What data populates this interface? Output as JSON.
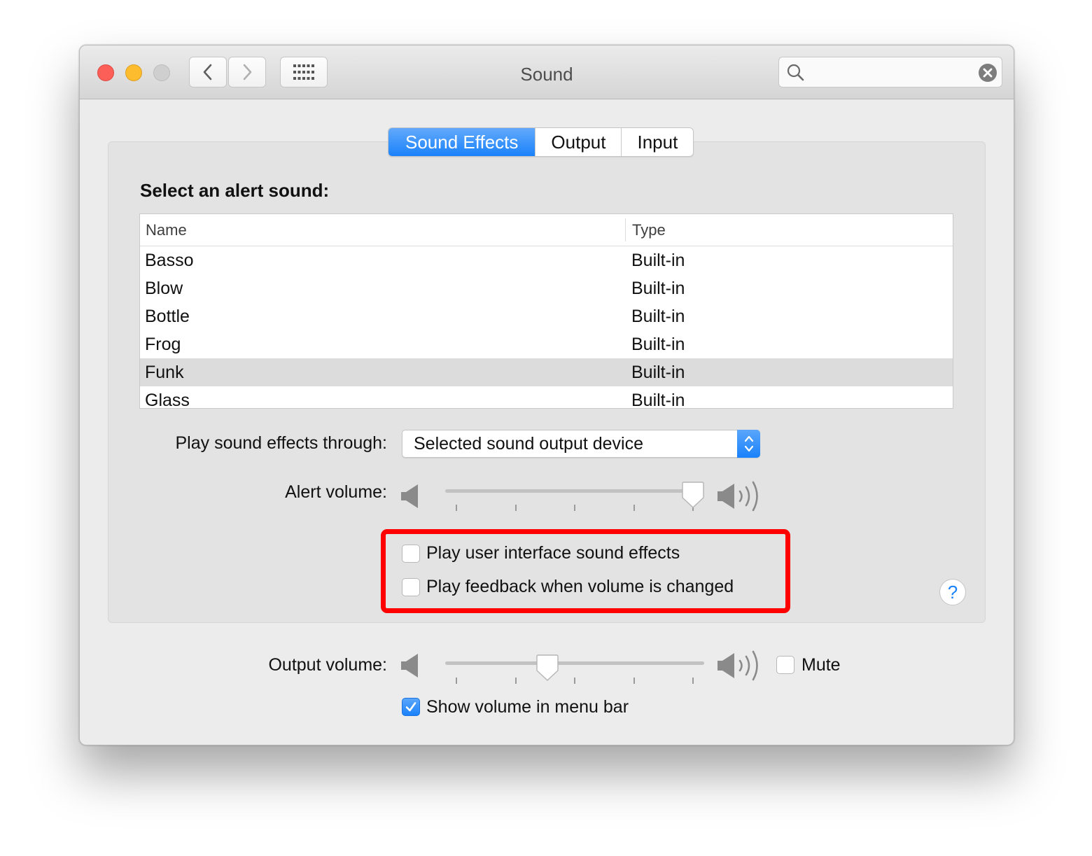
{
  "window": {
    "title": "Sound",
    "search": {
      "placeholder": "",
      "value": ""
    }
  },
  "tabs": [
    {
      "label": "Sound Effects",
      "active": true
    },
    {
      "label": "Output",
      "active": false
    },
    {
      "label": "Input",
      "active": false
    }
  ],
  "sound_effects": {
    "section_label": "Select an alert sound:",
    "table": {
      "columns": [
        "Name",
        "Type"
      ],
      "rows": [
        {
          "name": "Basso",
          "type": "Built-in"
        },
        {
          "name": "Blow",
          "type": "Built-in"
        },
        {
          "name": "Bottle",
          "type": "Built-in"
        },
        {
          "name": "Frog",
          "type": "Built-in"
        },
        {
          "name": "Funk",
          "type": "Built-in",
          "selected": true
        },
        {
          "name": "Glass",
          "type": "Built-in"
        }
      ]
    },
    "play_through_label": "Play sound effects through:",
    "play_through_value": "Selected sound output device",
    "alert_volume_label": "Alert volume:",
    "alert_volume_level": 1.0,
    "ui_sound_effects_label": "Play user interface sound effects",
    "ui_sound_effects_checked": false,
    "feedback_label": "Play feedback when volume is changed",
    "feedback_checked": false,
    "help_label": "?"
  },
  "output": {
    "volume_label": "Output volume:",
    "volume_level": 0.4,
    "mute_label": "Mute",
    "mute_checked": false,
    "show_in_menu_bar_label": "Show volume in menu bar",
    "show_in_menu_bar_checked": true
  },
  "colors": {
    "accent": "#1a82fb",
    "highlight_outline": "#ff0000",
    "close": "#fc5f57",
    "minimize": "#fdbc2e",
    "zoom_disabled": "#cfcfcf"
  },
  "icons": [
    "search-icon",
    "clear-search-icon",
    "chevron-left-icon",
    "chevron-right-icon",
    "grid-icon",
    "speaker-low-icon",
    "speaker-high-icon",
    "checkmark-icon",
    "up-down-arrows-icon"
  ]
}
